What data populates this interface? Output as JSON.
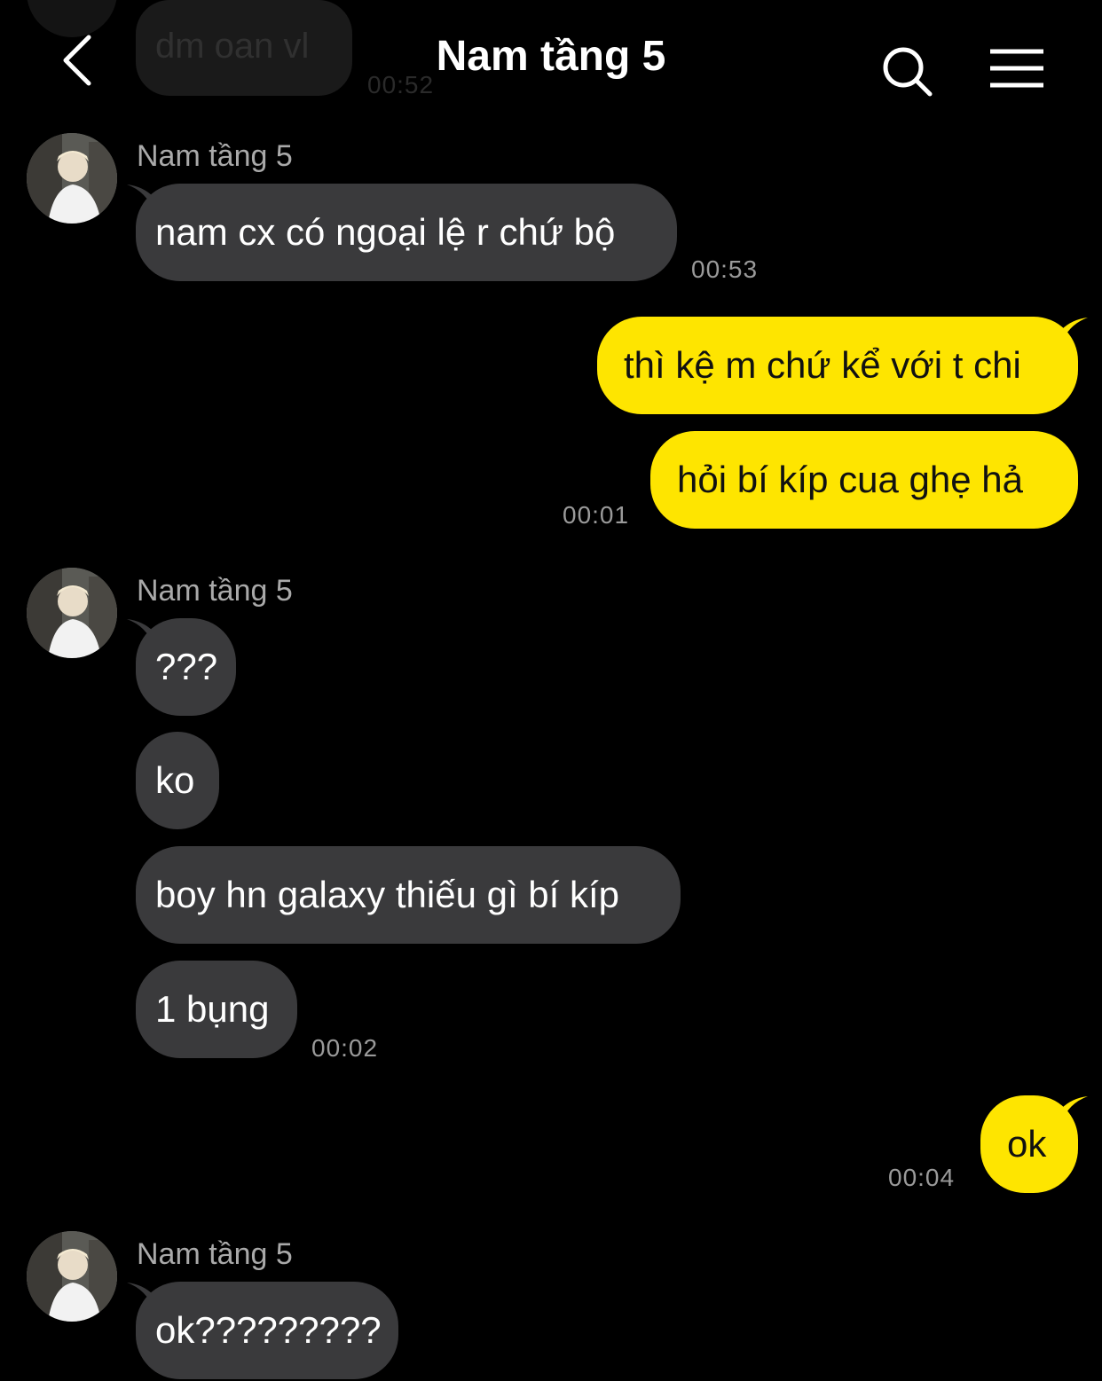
{
  "header": {
    "title": "Nam tầng 5",
    "back_icon": "chevron-left-icon",
    "search_icon": "search-icon",
    "menu_icon": "hamburger-menu-icon"
  },
  "colors": {
    "background": "#000000",
    "incoming_bubble": "#3a3a3c",
    "outgoing_bubble": "#fee500"
  },
  "faded_message": {
    "text": "dm oan vl",
    "time": "00:52"
  },
  "groups": [
    {
      "sender": "Nam tầng 5",
      "messages": [
        {
          "text": "nam cx có ngoại lệ r chứ bộ"
        }
      ],
      "time": "00:53"
    },
    {
      "outgoing": true,
      "messages": [
        {
          "text": "thì kệ m chứ kể với t chi"
        },
        {
          "text": "hỏi bí kíp cua ghẹ hả"
        }
      ],
      "time": "00:01"
    },
    {
      "sender": "Nam tầng 5",
      "messages": [
        {
          "text": "???"
        },
        {
          "text": "ko"
        },
        {
          "text": "boy hn galaxy thiếu gì bí kíp"
        },
        {
          "text": "1 bụng"
        }
      ],
      "time": "00:02"
    },
    {
      "outgoing": true,
      "messages": [
        {
          "text": "ok"
        }
      ],
      "time": "00:04"
    },
    {
      "sender": "Nam tầng 5",
      "messages": [
        {
          "text": "ok?????????"
        }
      ]
    }
  ]
}
